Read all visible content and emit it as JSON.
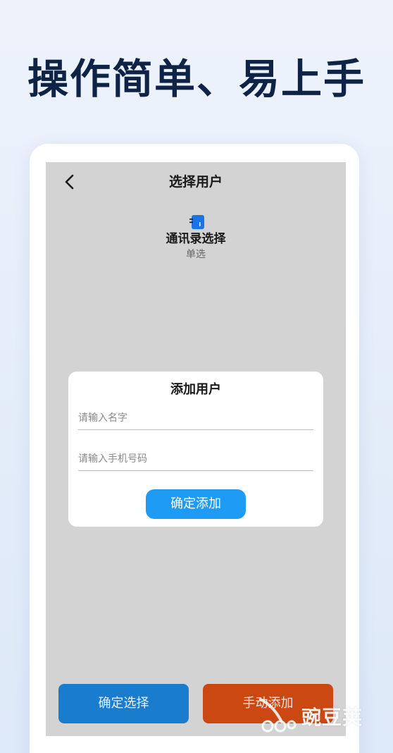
{
  "headline": "操作简单、易上手",
  "screen": {
    "nav_title": "选择用户",
    "contact": {
      "title": "通讯录选择",
      "subtitle": "单选"
    },
    "dialog": {
      "title": "添加用户",
      "name_placeholder": "请输入名字",
      "phone_placeholder": "请输入手机号码",
      "confirm_label": "确定添加"
    },
    "buttons": {
      "confirm_select": "确定选择",
      "manual_add": "手动添加"
    }
  },
  "watermark": "豌豆荚",
  "colors": {
    "headline": "#0f2347",
    "confirm_add": "#1e9cf5",
    "confirm_select": "#1a7ccd",
    "manual_add": "#cc4812",
    "overlay": "#d3d3d3"
  },
  "icons": {
    "back": "chevron-left-icon",
    "contact": "contact-book-icon"
  }
}
